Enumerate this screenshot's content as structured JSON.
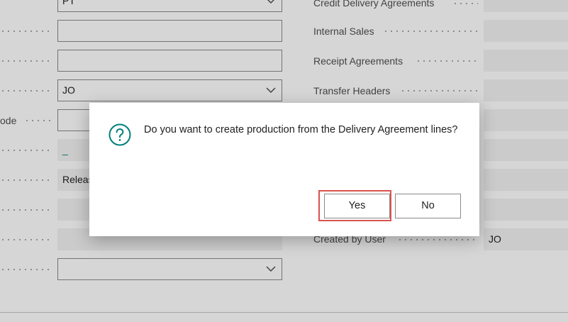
{
  "form": {
    "left_fields": [
      {
        "value": "PT",
        "type": "dropdown"
      },
      {
        "value": "",
        "type": "text"
      },
      {
        "value": "",
        "type": "text"
      },
      {
        "value": "JO",
        "type": "dropdown"
      },
      {
        "value": "",
        "type": "text"
      },
      {
        "value": "_",
        "type": "link"
      },
      {
        "value": "Releas",
        "type": "readonly"
      },
      {
        "value": "",
        "type": "readonly"
      },
      {
        "value": "",
        "type": "readonly"
      },
      {
        "value": "",
        "type": "dropdown"
      }
    ],
    "left_label_partial": "ode",
    "right_labels": [
      "Credit Delivery Agreements",
      "Internal Sales",
      "Receipt Agreements",
      "Transfer Headers",
      "Created by User"
    ],
    "right_values": {
      "created_by_user": "JO"
    }
  },
  "dialog": {
    "icon": "question-circle-icon",
    "message": "Do you want to create production from the Delivery Agreement lines?",
    "yes_label": "Yes",
    "no_label": "No",
    "accent_color": "#00807a",
    "highlight_color": "#d9534f"
  }
}
